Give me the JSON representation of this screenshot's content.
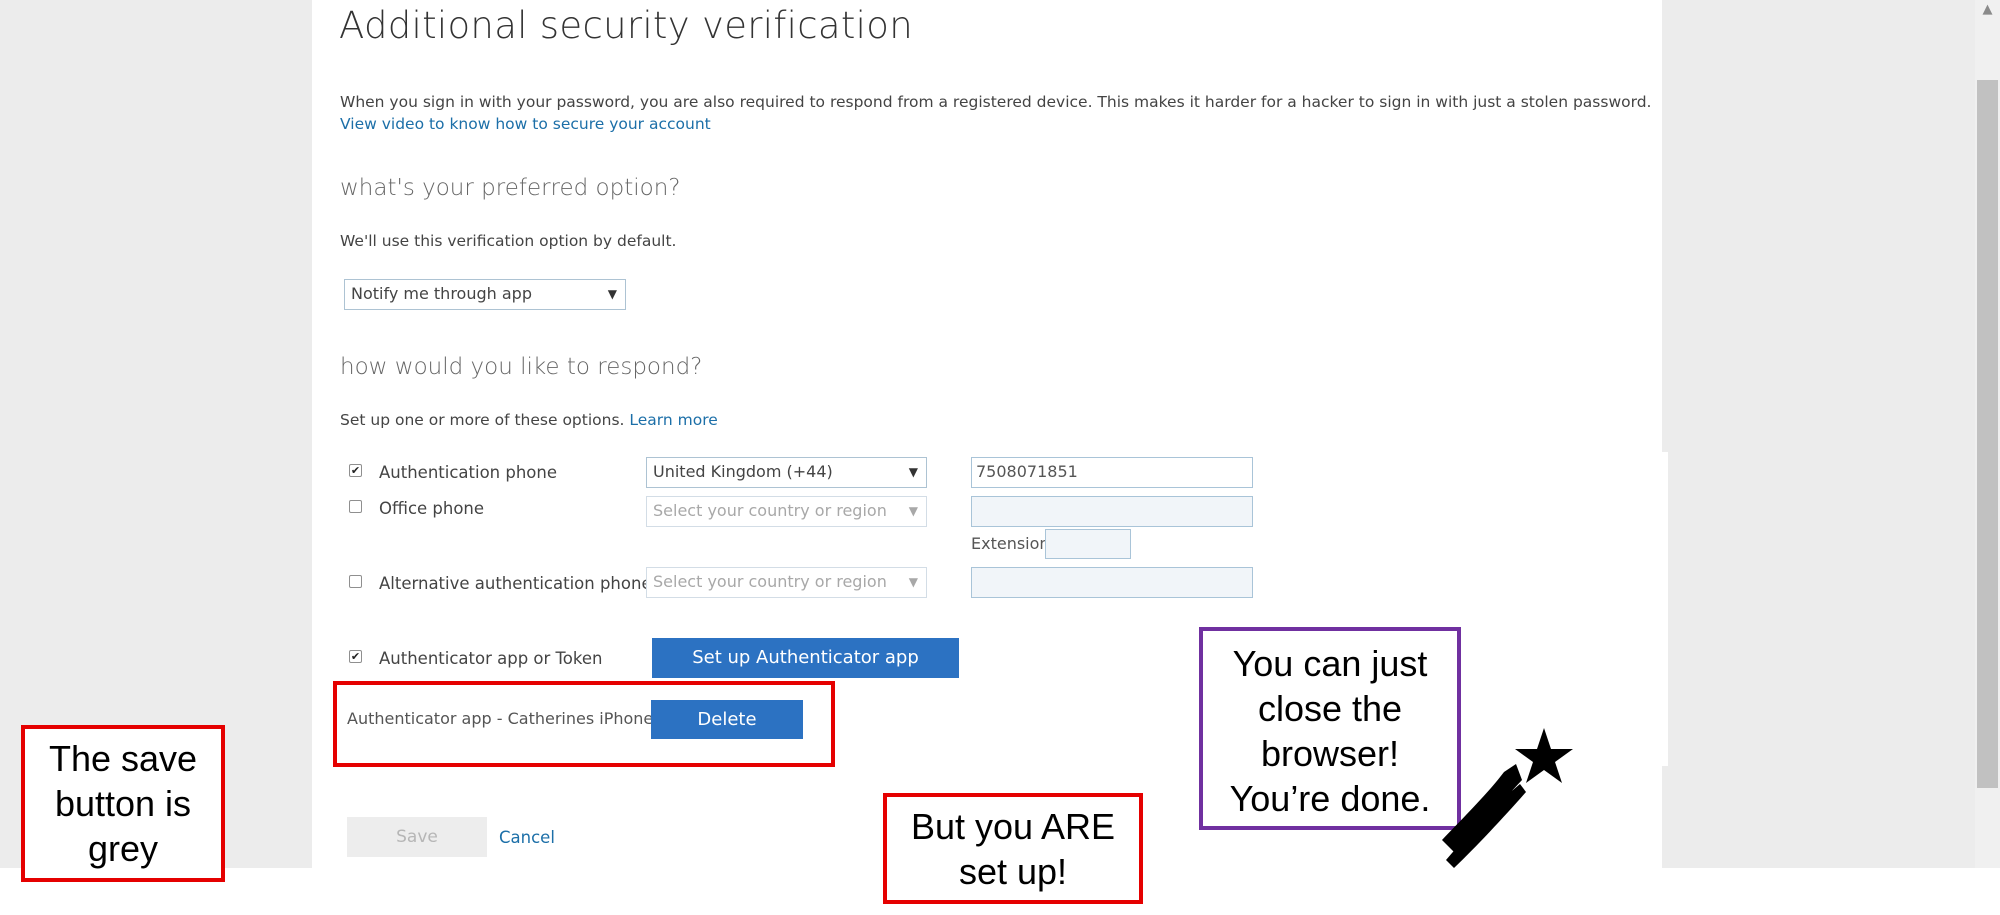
{
  "page": {
    "title": "Additional security verification",
    "intro_text": "When you sign in with your password, you are also required to respond from a registered device. This makes it harder for a hacker to sign in with just a stolen password.",
    "video_link": "View video to know how to secure your account"
  },
  "preferred": {
    "heading": "what's your preferred option?",
    "description": "We'll use this verification option by default.",
    "selected_option": "Notify me through app"
  },
  "respond": {
    "heading": "how would you like to respond?",
    "description": "Set up one or more of these options.",
    "learn_more": "Learn more",
    "auth_phone": {
      "label": "Authentication phone",
      "checked": true,
      "country": "United Kingdom (+44)",
      "number": "7508071851"
    },
    "office_phone": {
      "label": "Office phone",
      "checked": false,
      "country_placeholder": "Select your country or region",
      "extension_label": "Extension"
    },
    "alt_phone": {
      "label": "Alternative authentication phone",
      "checked": false,
      "country_placeholder": "Select your country or region"
    },
    "authenticator": {
      "label": "Authenticator app or Token",
      "checked": true,
      "setup_button": "Set up Authenticator app",
      "device_label": "Authenticator app - Catherines iPhone",
      "delete_button": "Delete"
    }
  },
  "actions": {
    "save": "Save",
    "cancel": "Cancel"
  },
  "annotations": {
    "save_note": [
      "The save",
      "button is",
      "grey"
    ],
    "setup_note": [
      "But you ARE",
      "set up!"
    ],
    "done_note": [
      "You can just",
      "close the",
      "browser!",
      "You’re done."
    ]
  },
  "colors": {
    "accent": "#2c72c2",
    "link": "#1c6fa8",
    "annotation_red": "#e50000",
    "annotation_purple": "#7030a0"
  },
  "icons": {
    "checkmark": "check-icon",
    "dropdown": "chevron-down-icon",
    "star": "shooting-star-icon"
  }
}
